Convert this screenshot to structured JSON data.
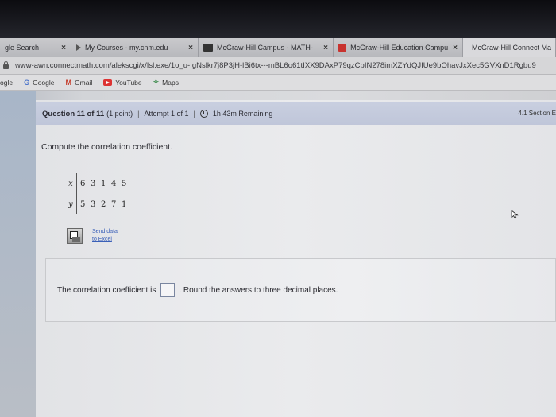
{
  "browser": {
    "tabs": [
      {
        "label": "gle Search",
        "close": "×"
      },
      {
        "label": "My Courses - my.cnm.edu",
        "close": "×"
      },
      {
        "label": "McGraw-Hill Campus - MATH-",
        "close": "×"
      },
      {
        "label": "McGraw-Hill Education Campu",
        "close": "×"
      },
      {
        "label": "McGraw-Hill Connect Ma",
        "close": ""
      }
    ],
    "url": "www-awn.connectmath.com/alekscgi/x/Isl.exe/1o_u-IgNslkr7j8P3jH-lBi6tx---mBL6o61tIXX9DAxP79qzCbIN278imXZYdQJIUe9bOhavJxXec5GVXnD1Rgbu9",
    "bookmarks": [
      {
        "label": "ogle",
        "icon": ""
      },
      {
        "label": "Google",
        "icon": "G"
      },
      {
        "label": "Gmail",
        "icon": "M"
      },
      {
        "label": "YouTube",
        "icon": "youtube-icon"
      },
      {
        "label": "Maps",
        "icon": "maps-icon"
      }
    ]
  },
  "question_header": {
    "number": "Question 11 of 11",
    "points": "(1 point)",
    "separator": "|",
    "attempt": "Attempt 1 of 1",
    "time_remaining": "1h 43m Remaining",
    "section": "4.1 Section E"
  },
  "prompt": "Compute the correlation coefficient.",
  "data_table": {
    "x_label": "x",
    "y_label": "y",
    "x_values": [
      "6",
      "3",
      "1",
      "4",
      "5"
    ],
    "y_values": [
      "5",
      "3",
      "2",
      "7",
      "1"
    ]
  },
  "excel_link": {
    "line1": "Send data",
    "line2": "to Excel"
  },
  "answer": {
    "label_before": "The correlation coefficient is",
    "input_value": "",
    "label_after": ". Round the answers to three decimal places."
  },
  "colors": {
    "header_bg": "#c5cbdd",
    "link": "#3a60b8"
  }
}
